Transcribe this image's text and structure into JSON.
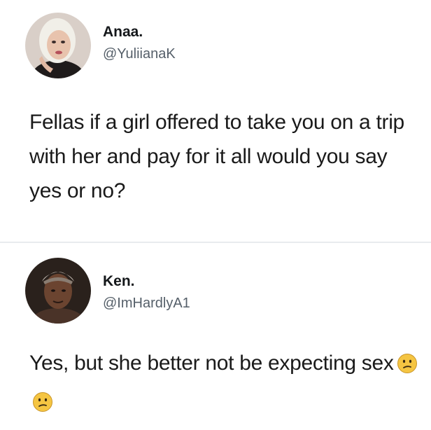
{
  "tweets": [
    {
      "display_name": "Anaa.",
      "handle": "@YuliianaK",
      "text": "Fellas if a girl offered to take you on a trip with her and pay for it all would you say yes or no?",
      "avatar_icon": "woman-portrait-avatar"
    },
    {
      "display_name": "Ken.",
      "handle": "@ImHardlyA1",
      "text": "Yes, but she better not be expecting sex",
      "emojis": [
        "confused-face-icon",
        "confused-face-icon"
      ],
      "avatar_icon": "man-portrait-avatar"
    }
  ],
  "colors": {
    "text": "#14171a",
    "handle": "#555f69",
    "divider": "#e8ebee",
    "emoji_fill": "#f5c542"
  }
}
